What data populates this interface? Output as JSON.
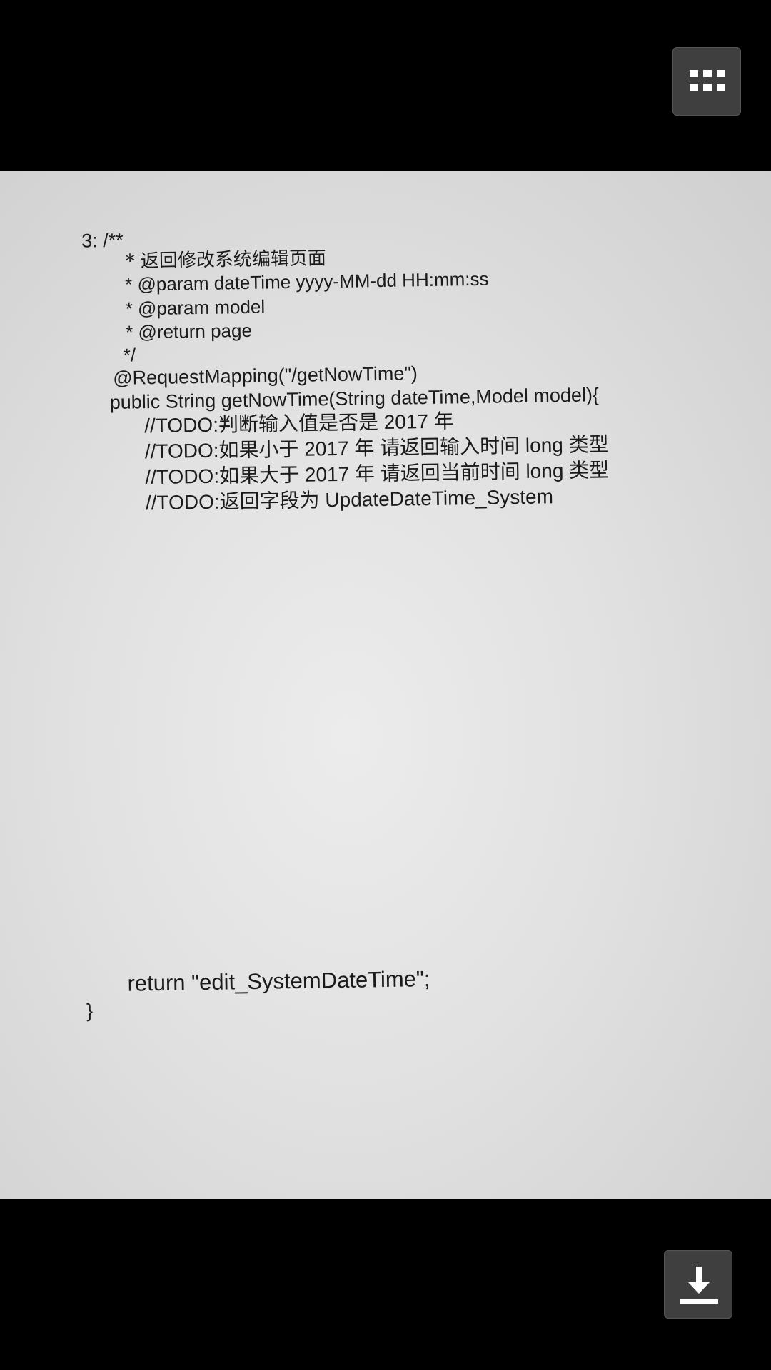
{
  "toolbar": {
    "grid_icon": "grid-icon",
    "download_icon": "download-icon"
  },
  "document": {
    "lines": [
      "3:  /**",
      "*  返回修改系统编辑页面",
      "* @param dateTime yyyy-MM-dd HH:mm:ss",
      "* @param model",
      "* @return page",
      "*/",
      "@RequestMapping(\"/getNowTime\")",
      "public String getNowTime(String dateTime,Model model){",
      "//TODO:判断输入值是否是 2017 年",
      "//TODO:如果小于 2017 年  请返回输入时间 long 类型",
      "//TODO:如果大于 2017 年  请返回当前时间 long 类型",
      "//TODO:返回字段为  UpdateDateTime_System",
      "return \"edit_SystemDateTime\";",
      "}"
    ]
  },
  "colors": {
    "background": "#000000",
    "paper": "#e4e4e4",
    "ink": "#1b1b1b",
    "button": "#3f3f3f"
  }
}
